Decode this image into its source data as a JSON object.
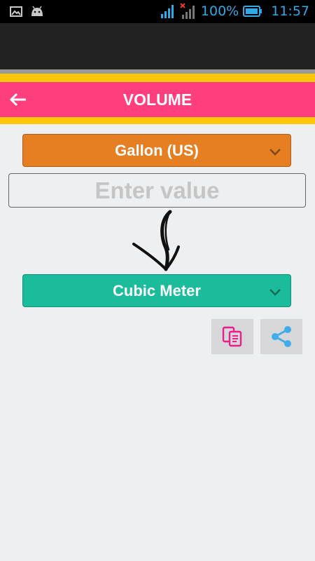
{
  "status_bar": {
    "battery": "100%",
    "time": "11:57"
  },
  "title_bar": {
    "back_icon": "arrow-left-icon",
    "title": "VOLUME"
  },
  "converter": {
    "from_unit": "Gallon (US)",
    "input_placeholder": "Enter value",
    "input_value": "",
    "to_unit": "Cubic Meter"
  },
  "actions": {
    "copy_icon": "copy-icon",
    "share_icon": "share-icon"
  },
  "colors": {
    "title_bar": "#ff3e7d",
    "accent_strip": "#ffc60a",
    "from_select": "#e67e22",
    "to_select": "#1abc9c",
    "copy_icon": "#e91e8c",
    "share_icon": "#3daee9"
  }
}
